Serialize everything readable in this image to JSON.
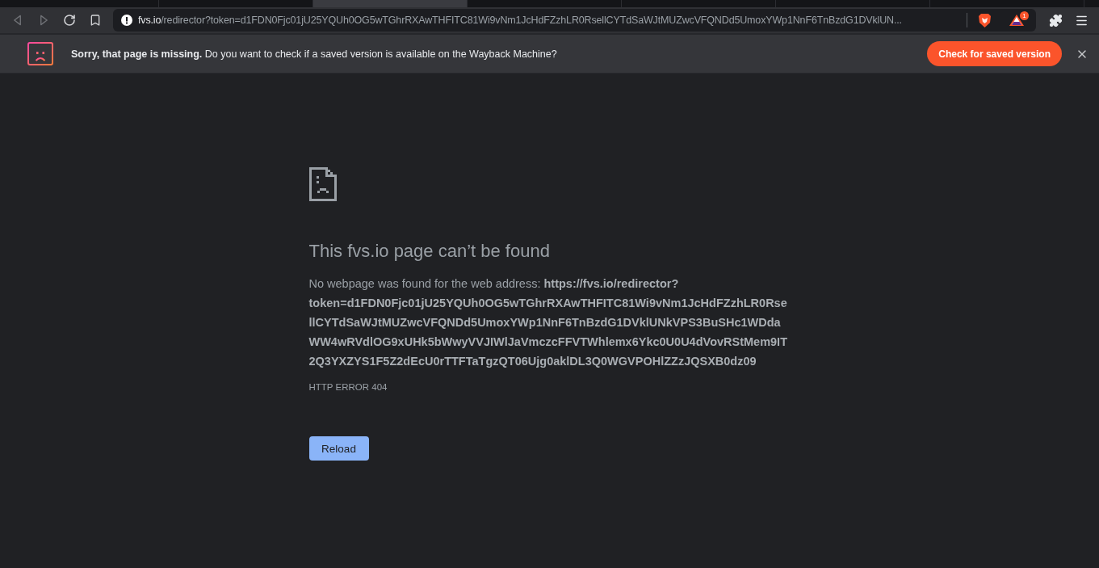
{
  "tabs": [
    {
      "selected": false
    },
    {
      "selected": false
    },
    {
      "selected": true
    },
    {
      "selected": false
    },
    {
      "selected": false
    },
    {
      "selected": false
    },
    {
      "selected": false
    }
  ],
  "toolbar": {
    "buttons": [
      {
        "kind": "back",
        "disabled": true
      },
      {
        "kind": "forward",
        "disabled": true
      },
      {
        "kind": "reload",
        "disabled": false
      },
      {
        "kind": "bookmark",
        "disabled": false
      }
    ]
  },
  "address_bar": {
    "host": "fvs.io",
    "path": "/redirector?token=d1FDN0Fjc01jU25YQUh0OG5wTGhrRXAwTHFITC81Wi9vNm1JcHdFZzhLR0RsellCYTdSaWJtMUZwcVFQNDd5UmoxYWp1NnF6TnBzdG1DVklUN...",
    "rewards_badge": "1"
  },
  "infobar": {
    "message": "**Sorry, that page is missing.** Do you want to check if a saved version is available on the Wayback Machine?",
    "action": "Check for saved version"
  },
  "error_page": {
    "heading": "This fvs.io page can’t be found",
    "message": "No webpage was found for the web address: **https://fvs.io/redirector?token=d1FDN0Fjc01jU25YQUh0OG5wTGhrRXAwTHFITC81Wi9vNm1JcHdFZzhLR0RsellCYTdSaWJtMUZwcVFQNDd5UmoxYWp1NnF6TnBzdG1DVklUNkVPS3BuSHc1WDdaWW4wRVdlOG9xUHk5bWwyVVJIWlJaVmczcFFVTWhlemx6Ykc0U0U4dVovRStMem9IT2Q3YXZYS1F5Z2dEcU0rTTFTaTgzQT06Ujg0aklDL3Q0WGVPOHlZZzJQSXB0dz09**",
    "error_code": "HTTP ERROR 404",
    "button": "Reload"
  }
}
